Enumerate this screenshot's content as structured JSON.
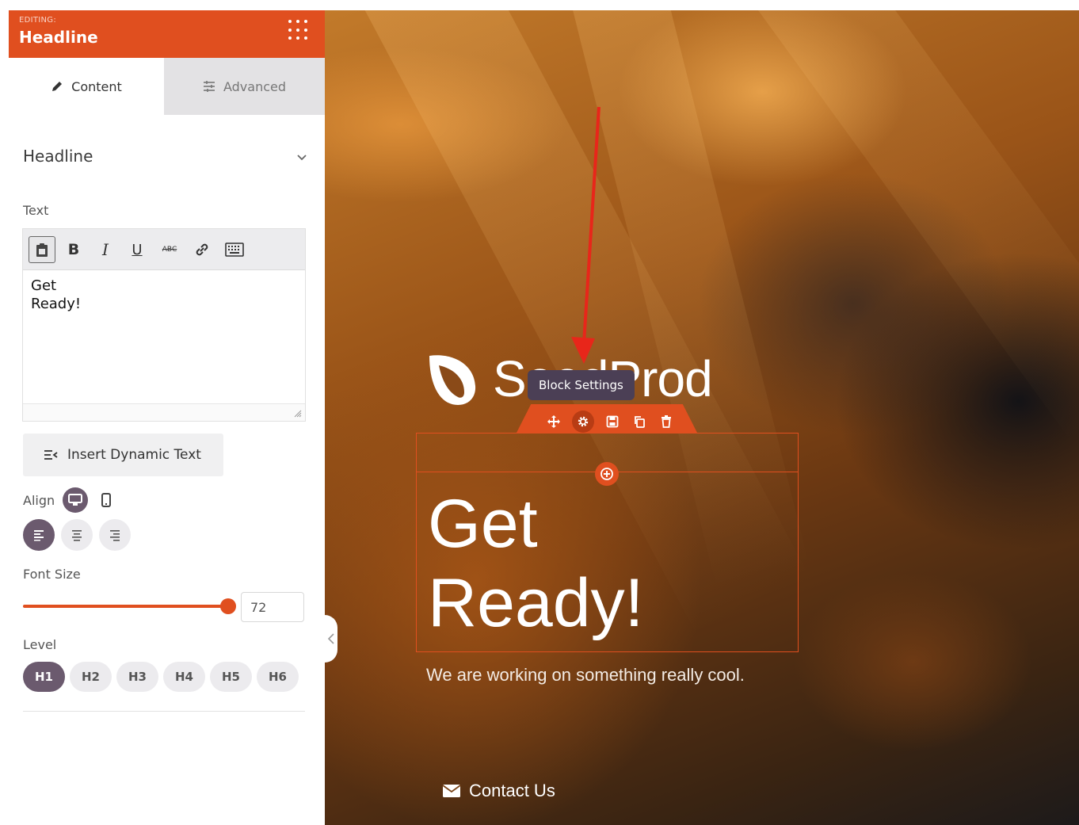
{
  "sidebar": {
    "header": {
      "editing_label": "EDITING:",
      "title": "Headline"
    },
    "tabs": [
      {
        "label": "Content",
        "icon": "pencil-icon"
      },
      {
        "label": "Advanced",
        "icon": "sliders-icon"
      }
    ],
    "section": {
      "title": "Headline"
    },
    "text_label": "Text",
    "toolbar": {
      "bold": "B",
      "italic": "I",
      "underline": "U",
      "strike": "ABC"
    },
    "text_value": "Get\nReady!",
    "dynamic_button": "Insert Dynamic Text",
    "align_label": "Align",
    "font_size_label": "Font Size",
    "font_size_value": "72",
    "font_size_fraction": 0.72,
    "level_label": "Level",
    "levels": [
      "H1",
      "H2",
      "H3",
      "H4",
      "H5",
      "H6"
    ]
  },
  "canvas": {
    "logo_text": "SeedProd",
    "tooltip": "Block Settings",
    "headline": "Get\nReady!",
    "subline": "We are working on something really cool.",
    "contact": "Contact Us"
  },
  "colors": {
    "accent": "#e04f1f",
    "active_pill": "#6b5a6e",
    "tooltip_bg": "#4b3f55",
    "arrow": "#e8261a"
  }
}
